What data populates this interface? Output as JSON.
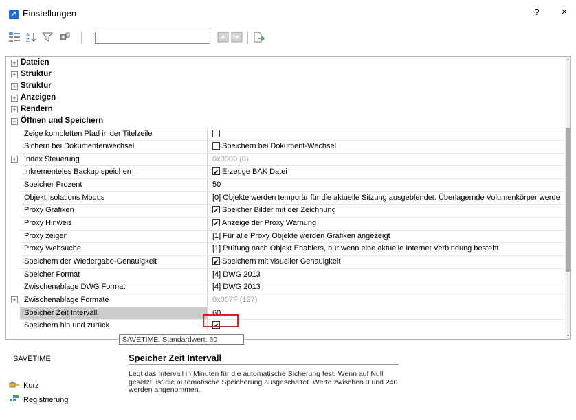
{
  "window": {
    "title": "Einstellungen",
    "help_label": "?",
    "close_label": "×"
  },
  "toolbar": {
    "search_value": ""
  },
  "categories_top": [
    "Dateien",
    "Struktur",
    "Struktur",
    "Anzeigen",
    "Rendern",
    "Öffnen und Speichern"
  ],
  "rows": [
    {
      "name": "Zeige kompletten Pfad in der Titelzeile",
      "value": "",
      "type": "checkbox",
      "checked": false,
      "expander": false
    },
    {
      "name": "Sichern bei Dokumentenwechsel",
      "value": "Speichern bei Dokument-Wechsel",
      "type": "checkbox",
      "checked": false,
      "expander": false
    },
    {
      "name": "Index Steuerung",
      "value": "0x0000 (0)",
      "type": "grey",
      "expander": true
    },
    {
      "name": "Inkrementeles Backup speichern",
      "value": "Erzeuge BAK Datei",
      "type": "checkbox",
      "checked": true,
      "expander": false
    },
    {
      "name": "Speicher Prozent",
      "value": "50",
      "type": "text",
      "expander": false
    },
    {
      "name": "Objekt Isolations Modus",
      "value": "[0] Objekte werden temporär für die aktuelle Sitzung ausgeblendet. Überlagernde Volumenkörper werde",
      "type": "text",
      "expander": false
    },
    {
      "name": "Proxy Grafiken",
      "value": "Speicher Bilder mit der Zeichnung",
      "type": "checkbox",
      "checked": true,
      "expander": false
    },
    {
      "name": "Proxy Hinweis",
      "value": "Anzeige der Proxy Warnung",
      "type": "checkbox",
      "checked": true,
      "expander": false
    },
    {
      "name": "Proxy zeigen",
      "value": "[1] Für alle Proxy Objekte werden Grafiken angezeigt",
      "type": "text",
      "expander": false
    },
    {
      "name": "Proxy Websuche",
      "value": "[1] Prüfung nach Objekt Enablers, nur wenn eine aktuelle Internet Verbindung besteht.",
      "type": "text",
      "expander": false
    },
    {
      "name": "Speichern der Wiedergabe-Genauigkeit",
      "value": "Speichern mit visueller Genauigkeit",
      "type": "checkbox",
      "checked": true,
      "expander": false
    },
    {
      "name": "Speicher Format",
      "value": "[4] DWG 2013",
      "type": "text",
      "expander": false
    },
    {
      "name": "Zwischenablage DWG Format",
      "value": "[4] DWG 2013",
      "type": "text",
      "expander": false
    },
    {
      "name": "Zwischenablage Formate",
      "value": "0x007F (127)",
      "type": "grey",
      "expander": true
    },
    {
      "name": "Speicher Zeit Intervall",
      "value": "60",
      "type": "text",
      "expander": false,
      "selected": true
    },
    {
      "name": "Speichern hin und zurück",
      "value": "",
      "type": "checkbox",
      "checked": true,
      "expander": false
    }
  ],
  "tooltip": "SAVETIME, Standardwert: 60",
  "details": {
    "variable": "SAVETIME",
    "title": "Speicher Zeit Intervall",
    "description": "Legt das Intervall in Minuten für die automatische Sicherung fest. Wenn auf Null gesetzt, ist die automatische Speicherung ausgeschaltet. Werte zwischen 0 und 240 werden angenommen."
  },
  "links": {
    "short": "Kurz",
    "registry": "Registrierung"
  }
}
